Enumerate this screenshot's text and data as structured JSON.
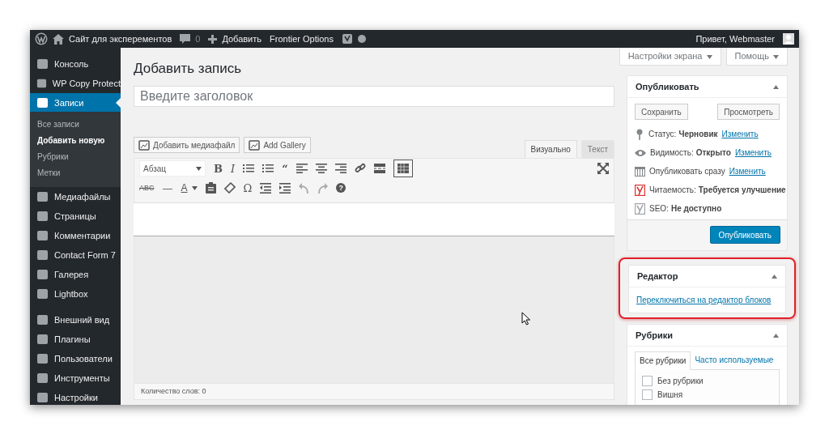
{
  "admin_bar": {
    "site": "Сайт для эксперементов",
    "comments": "0",
    "new": "Добавить",
    "frontier": "Frontier Options",
    "greeting": "Привет, Webmaster"
  },
  "sidebar": {
    "groups": [
      [
        {
          "label": "Консоль",
          "selected": false
        },
        {
          "label": "WP Copy Protect",
          "selected": false
        },
        {
          "label": "Записи",
          "selected": true,
          "children": [
            {
              "label": "Все записи",
              "selected": false
            },
            {
              "label": "Добавить новую",
              "selected": true
            },
            {
              "label": "Рубрики",
              "selected": false
            },
            {
              "label": "Метки",
              "selected": false
            }
          ]
        },
        {
          "label": "Медиафайлы",
          "selected": false
        },
        {
          "label": "Страницы",
          "selected": false
        },
        {
          "label": "Комментарии",
          "selected": false
        },
        {
          "label": "Contact Form 7",
          "selected": false
        },
        {
          "label": "Галерея",
          "selected": false
        },
        {
          "label": "Lightbox",
          "selected": false
        }
      ],
      [
        {
          "label": "Внешний вид",
          "selected": false
        },
        {
          "label": "Плагины",
          "selected": false
        },
        {
          "label": "Пользователи",
          "selected": false
        },
        {
          "label": "Инструменты",
          "selected": false
        },
        {
          "label": "Настройки",
          "selected": false
        }
      ]
    ]
  },
  "screen_options": "Настройки экрана",
  "help": "Помощь",
  "page_title": "Добавить запись",
  "title_field": {
    "placeholder": "Введите заголовок"
  },
  "media_buttons": [
    "Добавить медиафайл",
    "Add Gallery"
  ],
  "editor_tabs": [
    {
      "label": "Визуально",
      "selected": true
    },
    {
      "label": "Текст",
      "selected": false
    }
  ],
  "format_select": "Абзац",
  "toolbar_row_1": [
    {
      "kind": "bold",
      "text": "B"
    },
    {
      "kind": "italic",
      "text": "I"
    },
    {
      "kind": "bullets"
    },
    {
      "kind": "numbers"
    },
    {
      "kind": "bold",
      "text": "“"
    },
    {
      "kind": "alignleft"
    },
    {
      "kind": "aligncenter"
    },
    {
      "kind": "alignright"
    },
    {
      "kind": "link"
    },
    {
      "kind": "more"
    },
    {
      "kind": "toggle",
      "selected": true
    }
  ],
  "toolbar_row_2": [
    {
      "kind": "small",
      "text": "ABC"
    },
    {
      "kind": "glyph",
      "text": "—"
    },
    {
      "kind": "color",
      "text": "A"
    },
    {
      "kind": "paste"
    },
    {
      "kind": "eraser"
    },
    {
      "kind": "glyph",
      "text": "Ω"
    },
    {
      "kind": "outdent"
    },
    {
      "kind": "indent"
    },
    {
      "kind": "undo"
    },
    {
      "kind": "redo"
    },
    {
      "kind": "help",
      "text": "?"
    }
  ],
  "word_count": "Количество слов: 0",
  "publish": {
    "title": "Опубликовать",
    "save": "Сохранить",
    "preview": "Просмотреть",
    "rows": [
      {
        "kind": "status",
        "label": "Статус:",
        "value": "Черновик",
        "link": "Изменить"
      },
      {
        "kind": "visibility",
        "label": "Видимость:",
        "value": "Открыто",
        "link": "Изменить"
      },
      {
        "kind": "schedule",
        "label": "Опубликовать сразу",
        "link": "Изменить"
      },
      {
        "kind": "score",
        "label": "Читаемость:",
        "value": "Требуется улучшение",
        "color": "#dc3232"
      },
      {
        "kind": "score",
        "label": "SEO:",
        "value": "Не доступно",
        "color": "#a0a5aa"
      }
    ],
    "button": "Опубликовать"
  },
  "editor_box": {
    "title": "Редактор",
    "link": "Переключиться на редактор блоков",
    "highlighted": true
  },
  "categories": {
    "title": "Рубрики",
    "tabs": [
      {
        "label": "Все рубрики",
        "selected": true
      },
      {
        "label": "Часто используемые",
        "selected": false
      }
    ],
    "items": [
      {
        "label": "Без рубрики",
        "checked": false
      },
      {
        "label": "Вишня",
        "checked": false
      }
    ]
  }
}
